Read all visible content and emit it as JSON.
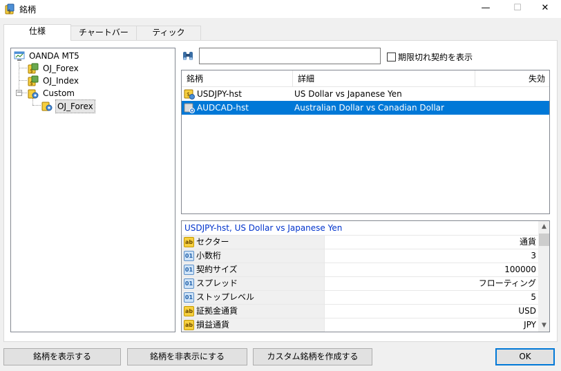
{
  "window": {
    "title": "銘柄",
    "minimize": "—",
    "maximize": "☐",
    "close": "✕"
  },
  "tabs": [
    {
      "label": "仕様"
    },
    {
      "label": "チャートバー"
    },
    {
      "label": "ティック"
    }
  ],
  "tree": {
    "root": "OANDA MT5",
    "items": [
      "OJ_Forex",
      "OJ_Index",
      "Custom"
    ],
    "custom_children": [
      "OJ_Forex"
    ]
  },
  "search": {
    "value": "",
    "placeholder": "",
    "show_expired_label": "期限切れ契約を表示"
  },
  "symbols": {
    "columns": [
      "銘柄",
      "詳細",
      "失効"
    ],
    "rows": [
      {
        "symbol": "USDJPY-hst",
        "description": "US Dollar vs Japanese Yen",
        "expiration": "",
        "selected": false
      },
      {
        "symbol": "AUDCAD-hst",
        "description": "Australian Dollar vs Canadian Dollar",
        "expiration": "",
        "selected": true
      }
    ]
  },
  "properties": {
    "header": "USDJPY-hst, US Dollar vs Japanese Yen",
    "rows": [
      {
        "icon": "ab-text-icon",
        "icon_text": "ab",
        "name": "セクター",
        "value": "通貨"
      },
      {
        "icon": "numeric-icon",
        "icon_text": "01",
        "name": "小数桁",
        "value": "3"
      },
      {
        "icon": "numeric-icon",
        "icon_text": "01",
        "name": "契約サイズ",
        "value": "100000"
      },
      {
        "icon": "numeric-icon",
        "icon_text": "01",
        "name": "スプレッド",
        "value": "フローティング"
      },
      {
        "icon": "numeric-icon",
        "icon_text": "01",
        "name": "ストップレベル",
        "value": "5"
      },
      {
        "icon": "ab-text-icon",
        "icon_text": "ab",
        "name": "証拠金通貨",
        "value": "USD"
      },
      {
        "icon": "ab-text-icon",
        "icon_text": "ab",
        "name": "損益通貨",
        "value": "JPY"
      }
    ]
  },
  "buttons": {
    "show": "銘柄を表示する",
    "hide": "銘柄を非表示にする",
    "create_custom": "カスタム銘柄を作成する",
    "ok": "OK"
  },
  "colors": {
    "selection": "#0078d7",
    "header_link": "#0033cc"
  }
}
